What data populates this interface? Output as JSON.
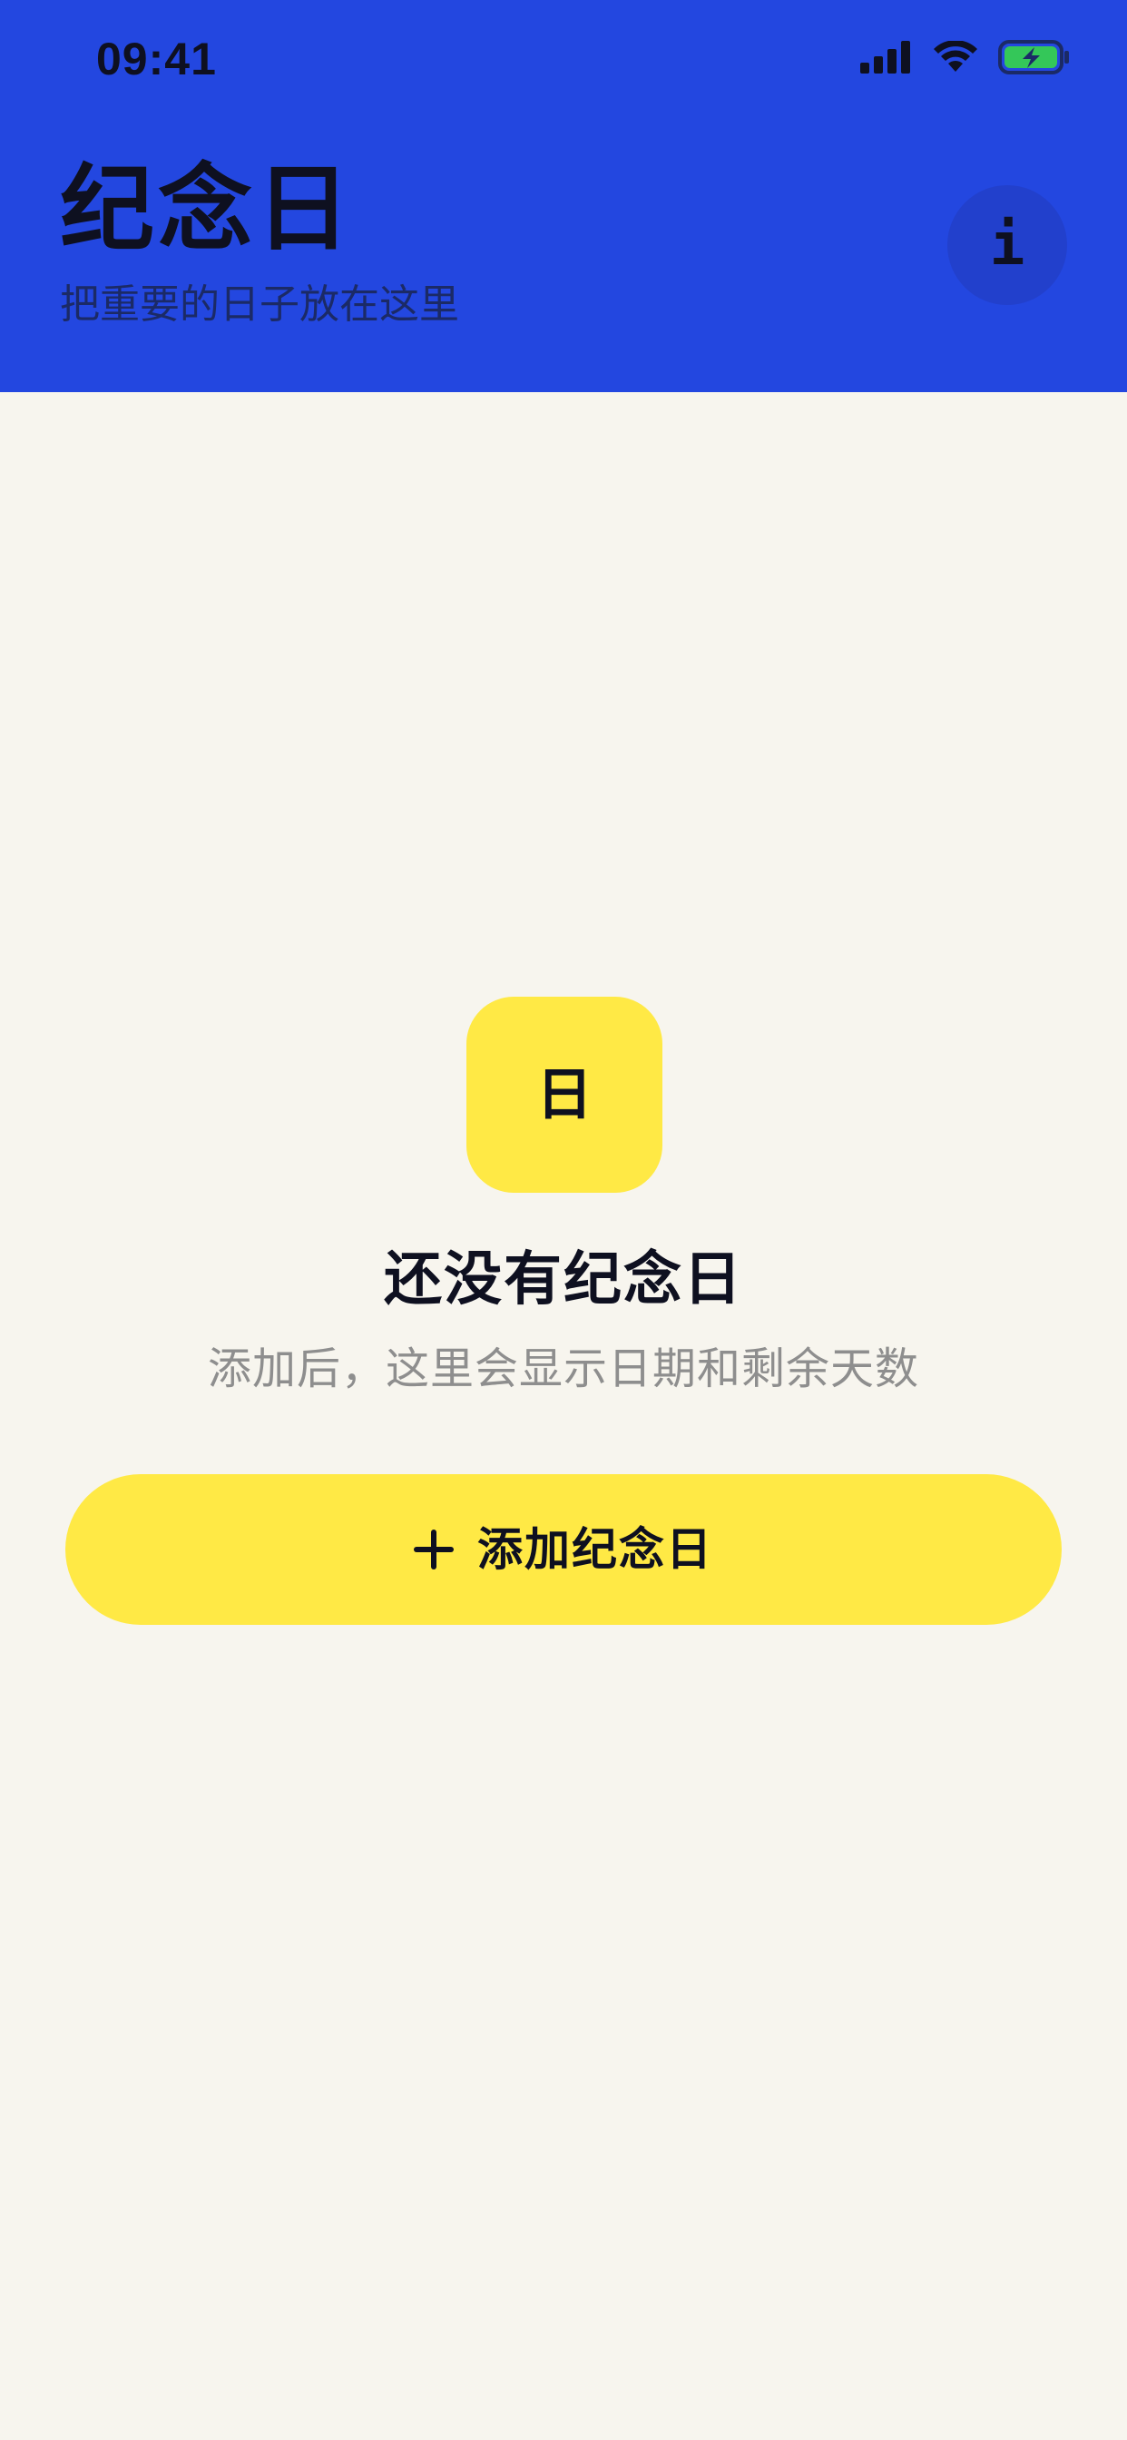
{
  "status_bar": {
    "time": "09:41",
    "icons": [
      "cellular-signal-icon",
      "wifi-icon",
      "battery-charging-icon"
    ],
    "battery_color": "#34C759"
  },
  "header": {
    "title": "纪念日",
    "subtitle": "把重要的日子放在这里",
    "info_glyph": "i",
    "background_color": "#2347E0"
  },
  "empty_state": {
    "icon_glyph": "日",
    "title": "还没有纪念日",
    "subtitle": "添加后，这里会显示日期和剩余天数",
    "accent_color": "#FFE945"
  },
  "add_button": {
    "label": "添加纪念日",
    "icon": "plus-icon"
  }
}
